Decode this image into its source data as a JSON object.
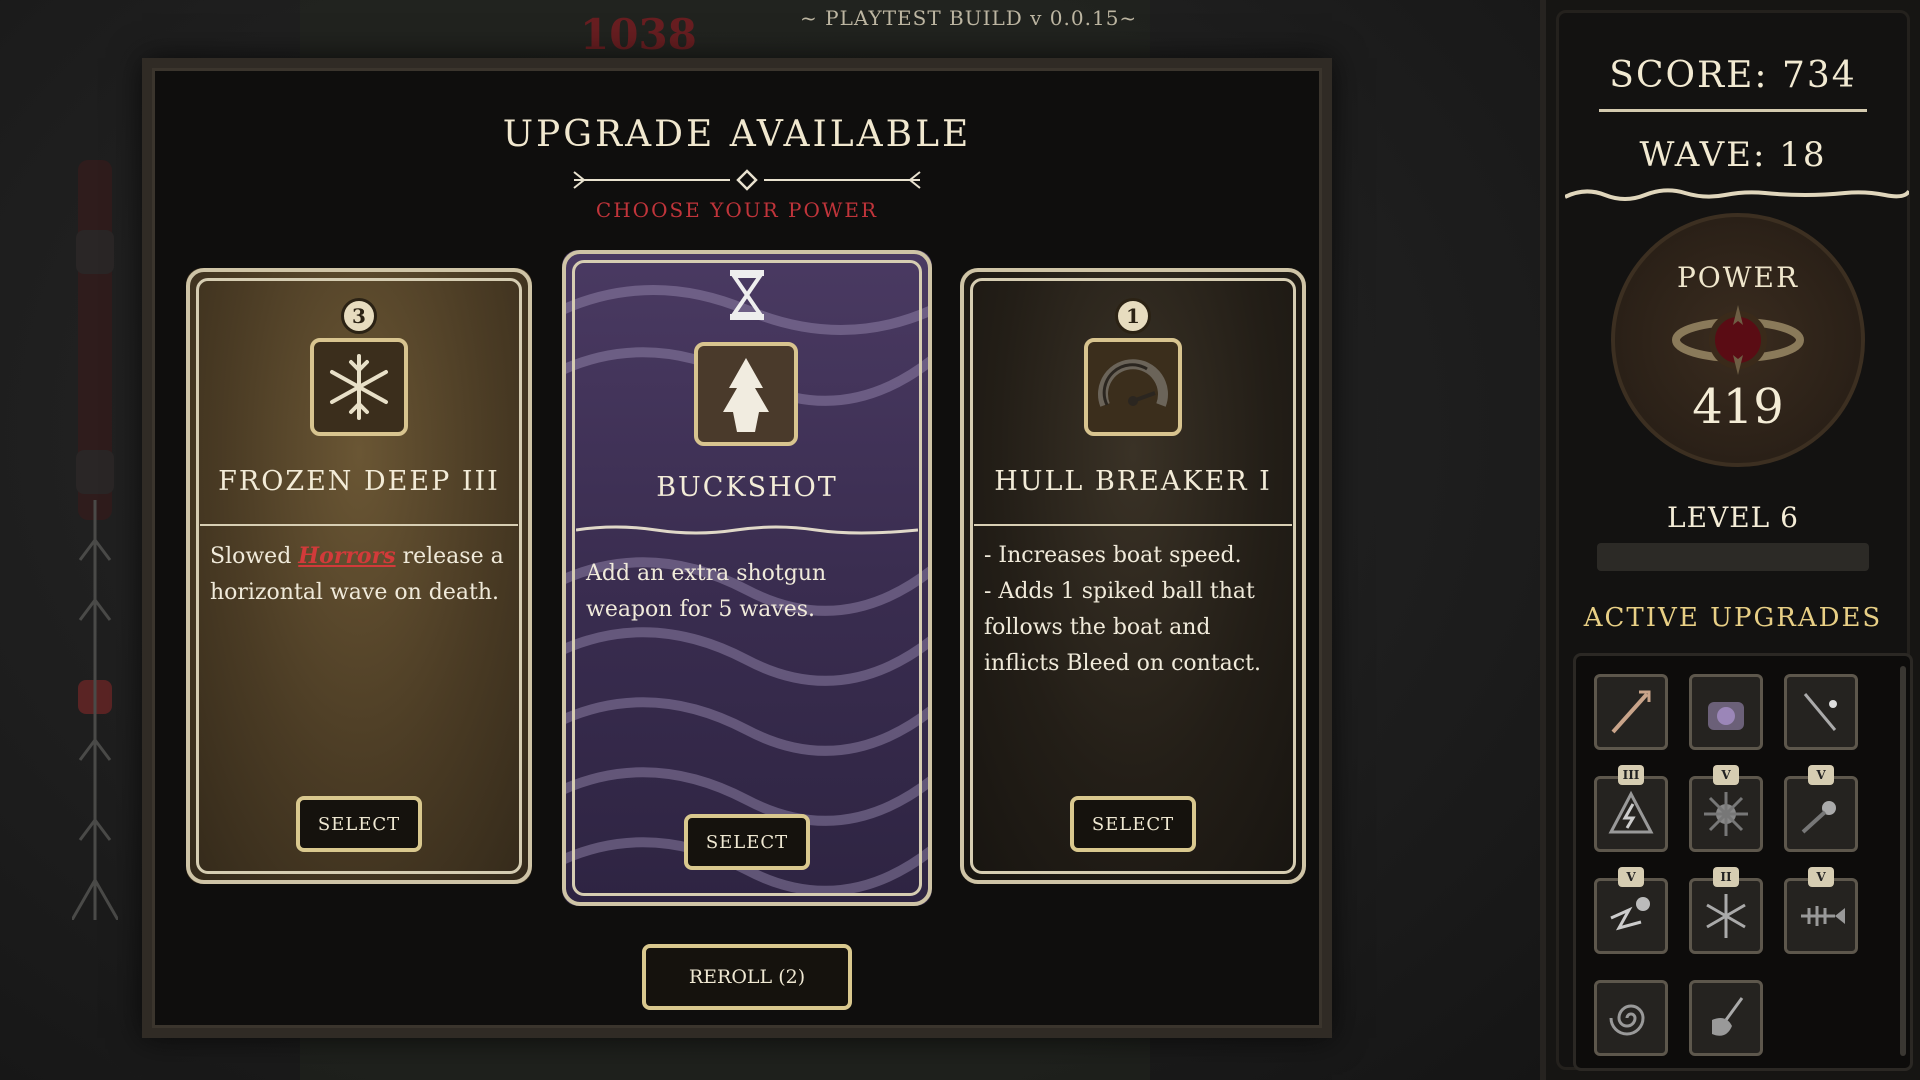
{
  "build_label": "~ PLAYTEST BUILD v 0.0.15~",
  "background": {
    "damage_number": "1038"
  },
  "modal": {
    "title": "UPGRADE AVAILABLE",
    "subtitle": "CHOOSE YOUR POWER",
    "reroll_label": "REROLL (2)"
  },
  "cards": [
    {
      "name": "FROZEN DEEP III",
      "tier": "3",
      "icon": "snowflake-icon",
      "desc_pre": "Slowed ",
      "desc_keyword": "Horrors",
      "desc_post": " release a horizontal wave on death.",
      "select_label": "SELECT",
      "style": "tan"
    },
    {
      "name": "BUCKSHOT",
      "tier_icon": "hourglass-icon",
      "icon": "tree-icon",
      "desc": "Add an extra shotgun weapon for 5 waves.",
      "select_label": "SELECT",
      "style": "purple"
    },
    {
      "name": "HULL BREAKER I",
      "tier": "1",
      "icon": "speedometer-icon",
      "desc_lines": [
        "- Increases boat speed.",
        "- Adds 1 spiked ball that follows the boat and inflicts Bleed on contact."
      ],
      "select_label": "SELECT",
      "style": "dark"
    }
  ],
  "sidebar": {
    "score_text": "SCORE: 734",
    "wave_text": "WAVE: 18",
    "power_label": "POWER",
    "power_value": "419",
    "level_text": "LEVEL 6",
    "xp_fraction": 0.0,
    "active_upgrades_title": "ACTIVE UPGRADES",
    "upgrades": [
      {
        "icon": "harpoon-icon",
        "tier": ""
      },
      {
        "icon": "diving-helmet-icon",
        "tier": ""
      },
      {
        "icon": "fishing-rod-icon",
        "tier": ""
      },
      {
        "icon": "lightning-triangle-icon",
        "tier": "III"
      },
      {
        "icon": "burst-icon",
        "tier": "V"
      },
      {
        "icon": "comet-icon",
        "tier": "V"
      },
      {
        "icon": "zigzag-ball-icon",
        "tier": "V"
      },
      {
        "icon": "snowflake-icon",
        "tier": "II"
      },
      {
        "icon": "fish-skeleton-icon",
        "tier": "V"
      },
      {
        "icon": "vortex-icon",
        "tier": ""
      },
      {
        "icon": "ladle-icon",
        "tier": ""
      }
    ]
  },
  "colors": {
    "accent_gold": "#d9c88e",
    "keyword_red": "#d23a3a",
    "subtitle_red": "#c0343a",
    "card_purple": "#3a2d50"
  }
}
